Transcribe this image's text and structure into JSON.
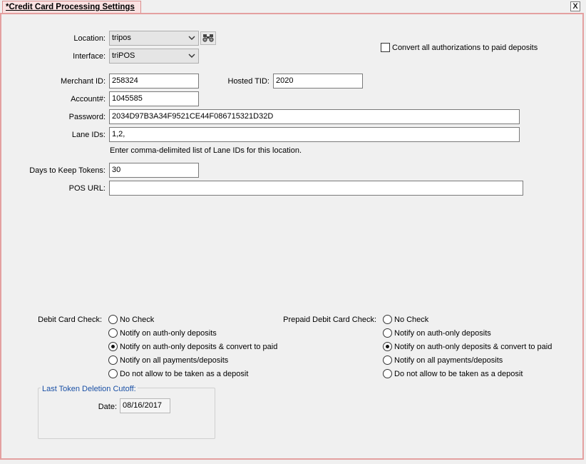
{
  "tab": {
    "title": "*Credit Card Processing Settings",
    "close_label": "X"
  },
  "fields": {
    "location": {
      "label": "Location:",
      "value": "tripos"
    },
    "interface": {
      "label": "Interface:",
      "value": "triPOS"
    },
    "convert_all": {
      "label": "Convert all authorizations to paid deposits",
      "checked": false
    },
    "merchant_id": {
      "label": "Merchant ID:",
      "value": "258324"
    },
    "hosted_tid": {
      "label": "Hosted TID:",
      "value": "2020"
    },
    "account": {
      "label": "Account#:",
      "value": "1045585"
    },
    "password": {
      "label": "Password:",
      "value": "2034D97B3A34F9521CE44F086715321D32D"
    },
    "lane_ids": {
      "label": "Lane IDs:",
      "value": "1,2,",
      "hint": "Enter comma-delimited list of Lane IDs for this location."
    },
    "days_tokens": {
      "label": "Days to Keep Tokens:",
      "value": "30"
    },
    "pos_url": {
      "label": "POS URL:",
      "value": ""
    }
  },
  "debit_check": {
    "label": "Debit Card Check:",
    "options": [
      {
        "label": "No Check",
        "selected": false
      },
      {
        "label": "Notify on auth-only deposits",
        "selected": false
      },
      {
        "label": "Notify on auth-only deposits & convert to paid",
        "selected": true
      },
      {
        "label": "Notify on all payments/deposits",
        "selected": false
      },
      {
        "label": "Do not allow to be taken as a deposit",
        "selected": false
      }
    ]
  },
  "prepaid_check": {
    "label": "Prepaid Debit Card Check:",
    "options": [
      {
        "label": "No Check",
        "selected": false
      },
      {
        "label": "Notify on auth-only deposits",
        "selected": false
      },
      {
        "label": "Notify on auth-only deposits & convert to paid",
        "selected": true
      },
      {
        "label": "Notify on all payments/deposits",
        "selected": false
      },
      {
        "label": "Do not allow to be taken as a deposit",
        "selected": false
      }
    ]
  },
  "token_cutoff": {
    "title": "Last Token Deletion Cutoff:",
    "date_label": "Date:",
    "date_value": "08/16/2017"
  },
  "colors": {
    "tab_bg": "#fae2e2",
    "panel_border": "#e4a0a0",
    "group_title": "#1a50a5"
  },
  "icons": {
    "close": "close-icon",
    "search": "binoculars-icon",
    "dropdown": "chevron-down-icon"
  }
}
